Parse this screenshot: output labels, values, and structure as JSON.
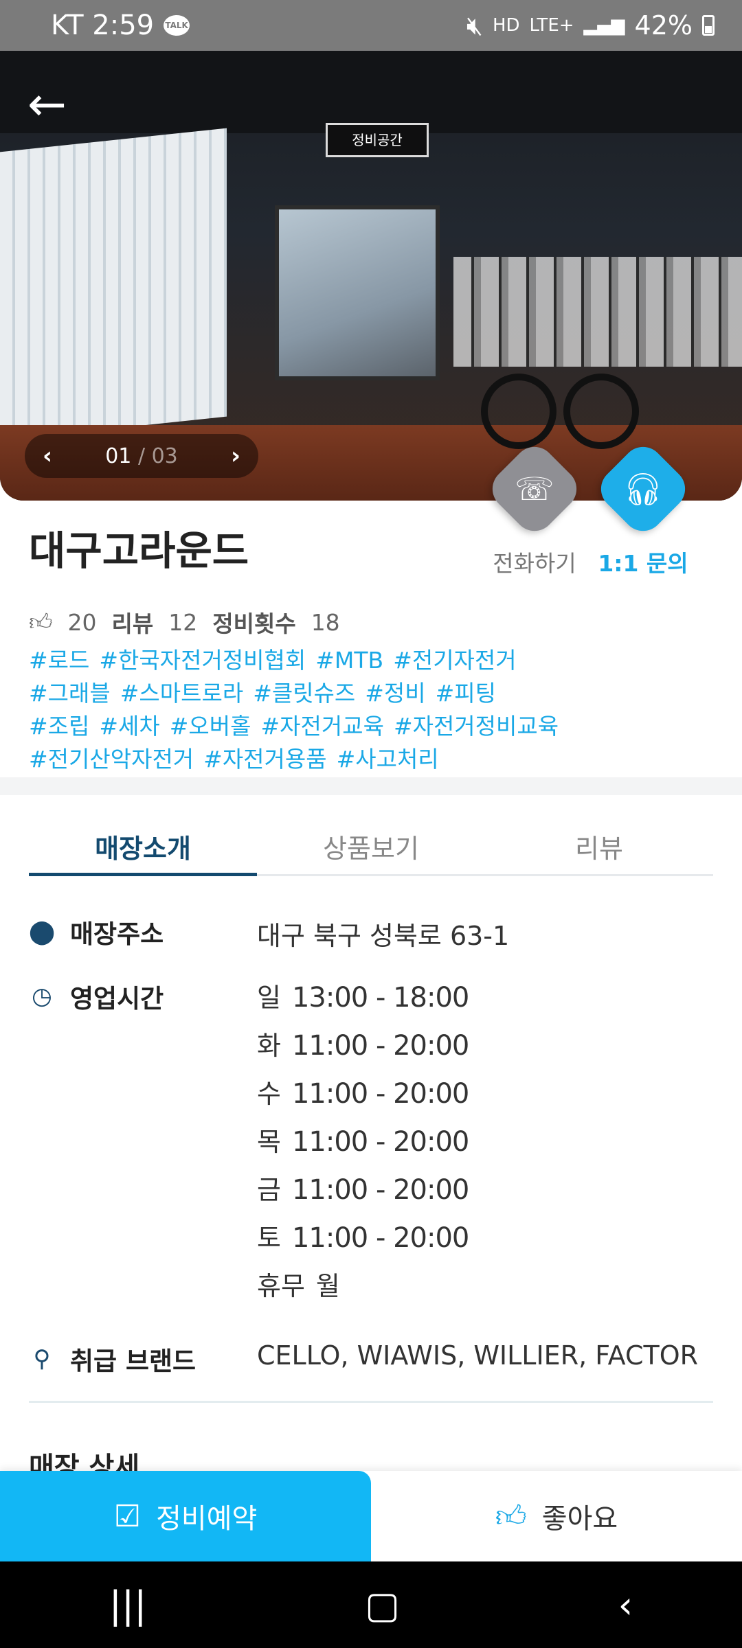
{
  "status_bar": {
    "carrier_time": "KT 2:59",
    "talk_badge": "TALK",
    "hd": "HD",
    "network": "LTE+",
    "battery": "42%"
  },
  "hero": {
    "photo_sign": "정비공간",
    "pager_current": "01",
    "pager_sep": " / ",
    "pager_total": "03"
  },
  "actions": {
    "call_label": "전화하기",
    "inquiry_label": "1:1 문의"
  },
  "store": {
    "name": "대구고라운드",
    "likes": "20",
    "review_label": "리뷰",
    "review_count": "12",
    "repair_label": "정비횟수",
    "repair_count": "18",
    "hashtags": [
      "#로드",
      "#한국자전거정비협회",
      "#MTB",
      "#전기자전거",
      "#그래블",
      "#스마트로라",
      "#클릿슈즈",
      "#정비",
      "#피팅",
      "#조립",
      "#세차",
      "#오버홀",
      "#자전거교육",
      "#자전거정비교육",
      "#전기산악자전거",
      "#자전거용품",
      "#사고처리"
    ]
  },
  "tabs": [
    "매장소개",
    "상품보기",
    "리뷰"
  ],
  "info": {
    "address_label": "매장주소",
    "address": "대구 북구 성북로 63-1",
    "hours_label": "영업시간",
    "hours": [
      {
        "day": "일",
        "time": "13:00 - 18:00"
      },
      {
        "day": "화",
        "time": "11:00 - 20:00"
      },
      {
        "day": "수",
        "time": "11:00 - 20:00"
      },
      {
        "day": "목",
        "time": "11:00 - 20:00"
      },
      {
        "day": "금",
        "time": "11:00 - 20:00"
      },
      {
        "day": "토",
        "time": "11:00 - 20:00"
      }
    ],
    "closed_label": "휴무",
    "closed_day": "월",
    "brands_label": "취급 브랜드",
    "brands": "CELLO, WIAWIS, WILLIER, FACTOR"
  },
  "detail_title": "매장 상세",
  "bottom_bar": {
    "reserve_label": "정비예약",
    "like_label": "좋아요"
  }
}
